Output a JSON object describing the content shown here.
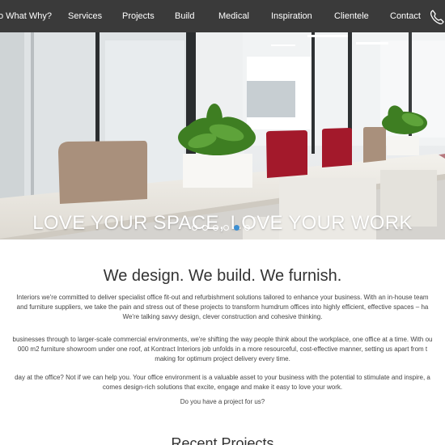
{
  "nav": {
    "items": [
      "o What Why?",
      "Services",
      "Projects",
      "Build",
      "Medical",
      "Inspiration",
      "Clientele",
      "Contact"
    ],
    "phone_icon": "phone-icon"
  },
  "hero": {
    "caption": "LOVE YOUR SPACE, LOVE YOUR WORK",
    "slide_count": 6,
    "active_slide": 5
  },
  "intro": {
    "heading": "We design. We build. We furnish.",
    "p1": [
      "Interiors we're committed to deliver specialist office fit-out and refurbishment solutions tailored to enhance your business. With an in-house team",
      "and furniture suppliers, we take the pain and stress out of these projects to transform humdrum offices into highly efficient, effective spaces – ha",
      "We're talking savvy design, clever construction and cohesive thinking."
    ],
    "p2": [
      "businesses through to larger-scale commercial environments, we're shifting the way people think about the workplace, one office at a time. With ou",
      "000 m2 furniture showroom under one roof, at Kontract Interiors job unfolds in a more resourceful, cost-effective manner, setting us apart from t",
      "making for optimum project delivery every time."
    ],
    "p3": [
      "day at the office? Not if we can help you. Your office environment is a valuable asset to your business with the potential to stimulate and inspire, a",
      "comes design-rich solutions that excite, engage and make it easy to love your work."
    ],
    "p4": "Do you have a project for us?"
  },
  "recent": {
    "heading": "Recent Projects"
  },
  "colors": {
    "nav_bg": "#3a3a3a",
    "accent": "#3d8fd1",
    "screen_red": "#a3192b",
    "screen_tan": "#a9907c"
  }
}
